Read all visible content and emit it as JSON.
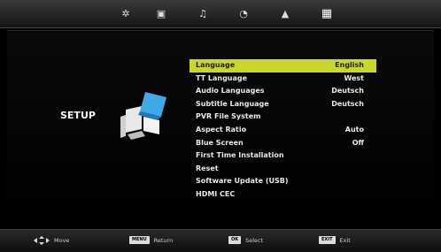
{
  "top_tabs": [
    {
      "name": "picture-icon",
      "glyph": "✲",
      "active": false
    },
    {
      "name": "sound-icon",
      "glyph": "▣",
      "active": false
    },
    {
      "name": "music-icon",
      "glyph": "♫",
      "active": false
    },
    {
      "name": "time-icon",
      "glyph": "◔",
      "active": false
    },
    {
      "name": "lock-icon",
      "glyph": "▲",
      "active": false
    },
    {
      "name": "setup-icon",
      "glyph": "▦",
      "active": true
    }
  ],
  "page_title": "SETUP",
  "menu": [
    {
      "label": "Language",
      "value": "English",
      "selected": true
    },
    {
      "label": "TT Language",
      "value": "West",
      "selected": false
    },
    {
      "label": "Audio Languages",
      "value": "Deutsch",
      "selected": false
    },
    {
      "label": "Subtitle Language",
      "value": "Deutsch",
      "selected": false
    },
    {
      "label": "PVR File System",
      "value": "",
      "selected": false
    },
    {
      "label": "Aspect Ratio",
      "value": "Auto",
      "selected": false
    },
    {
      "label": "Blue Screen",
      "value": "Off",
      "selected": false
    },
    {
      "label": "First Time Installation",
      "value": "",
      "selected": false
    },
    {
      "label": "Reset",
      "value": "",
      "selected": false
    },
    {
      "label": "Software Update (USB)",
      "value": "",
      "selected": false
    },
    {
      "label": "HDMI CEC",
      "value": "",
      "selected": false
    }
  ],
  "footer": {
    "move_label": "Move",
    "return_key": "MENU",
    "return_label": "Return",
    "select_key": "OK",
    "select_label": "Select",
    "exit_key": "EXIT",
    "exit_label": "Exit"
  },
  "colors": {
    "highlight": "#c9d62c",
    "art_blue": "#3fa9e8"
  }
}
